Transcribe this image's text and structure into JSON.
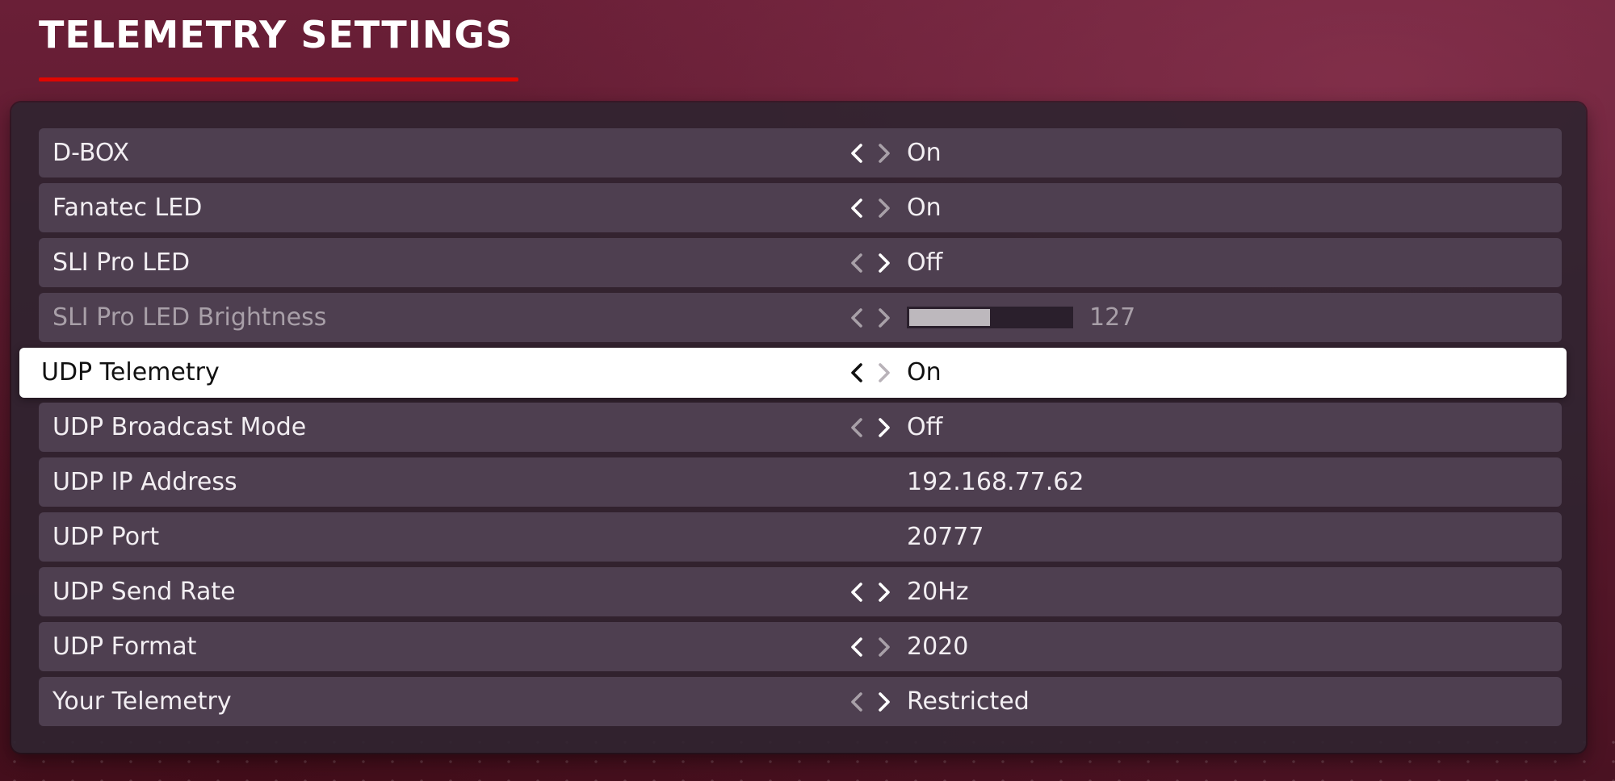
{
  "page_title": "TELEMETRY SETTINGS",
  "colors": {
    "accent": "#e10600",
    "row_background": "#4e3f50",
    "selected_row_background": "#ffffff",
    "active_arrow": "#ffffff",
    "inactive_arrow": "#a8a0a8"
  },
  "settings": [
    {
      "label": "D-BOX",
      "value": "On",
      "left_arrow": "active",
      "right_arrow": "inactive"
    },
    {
      "label": "Fanatec LED",
      "value": "On",
      "left_arrow": "active",
      "right_arrow": "inactive"
    },
    {
      "label": "SLI Pro LED",
      "value": "Off",
      "left_arrow": "inactive",
      "right_arrow": "active"
    },
    {
      "label": "SLI Pro LED Brightness",
      "value": "127",
      "slider_level": 0.5,
      "disabled": true,
      "left_arrow": "inactive",
      "right_arrow": "inactive"
    },
    {
      "label": "UDP Telemetry",
      "value": "On",
      "selected": true,
      "left_arrow": "active",
      "right_arrow": "inactive"
    },
    {
      "label": "UDP Broadcast Mode",
      "value": "Off",
      "left_arrow": "inactive",
      "right_arrow": "active"
    },
    {
      "label": "UDP IP Address",
      "value": "192.168.77.62"
    },
    {
      "label": "UDP Port",
      "value": "20777"
    },
    {
      "label": "UDP Send Rate",
      "value": "20Hz",
      "left_arrow": "active",
      "right_arrow": "active"
    },
    {
      "label": "UDP Format",
      "value": "2020",
      "left_arrow": "active",
      "right_arrow": "inactive"
    },
    {
      "label": "Your Telemetry",
      "value": "Restricted",
      "left_arrow": "inactive",
      "right_arrow": "active"
    }
  ],
  "icons": {
    "left_arrow": "chevron-left-icon",
    "right_arrow": "chevron-right-icon"
  }
}
